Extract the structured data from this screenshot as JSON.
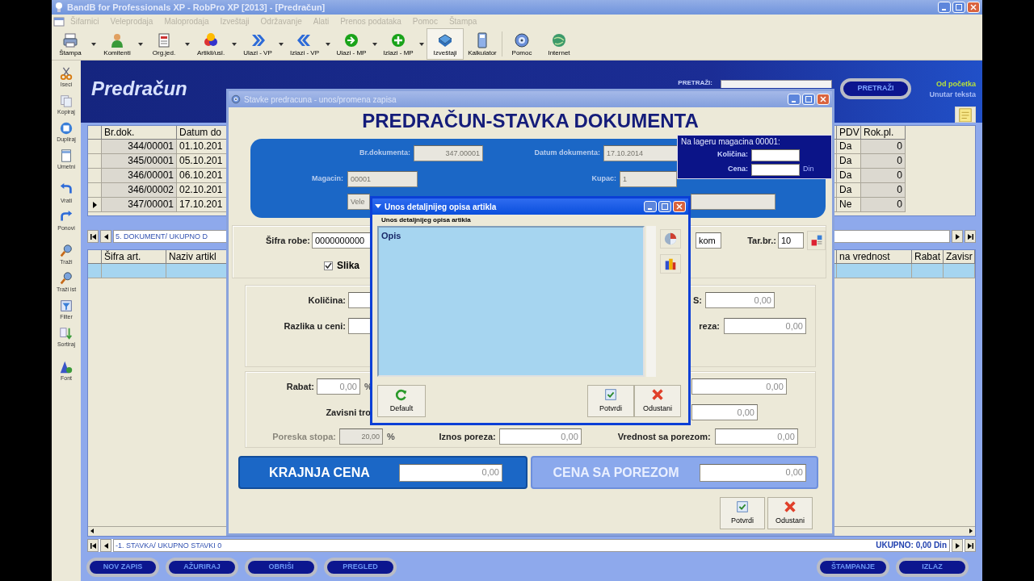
{
  "window": {
    "title": "BandB for Professionals XP - RobPro XP [2013] - [Predračun]"
  },
  "menu": [
    {
      "label": "Šifarnici",
      "disabled": true
    },
    {
      "label": "Veleprodaja",
      "disabled": true
    },
    {
      "label": "Maloprodaja",
      "disabled": true
    },
    {
      "label": "Izveštaji",
      "disabled": true
    },
    {
      "label": "Održavanje",
      "disabled": true
    },
    {
      "label": "Alati",
      "disabled": true
    },
    {
      "label": "Prenos podataka",
      "disabled": true
    },
    {
      "label": "Pomoc",
      "disabled": true
    },
    {
      "label": "Štampa",
      "disabled": true
    }
  ],
  "toolbar": [
    {
      "label": "Štampa",
      "dropdown": true,
      "selected": false
    },
    {
      "label": "Komitenti",
      "dropdown": true,
      "selected": false
    },
    {
      "label": "Org.jed.",
      "dropdown": true,
      "selected": false
    },
    {
      "label": "Artikli/usl.",
      "dropdown": true,
      "selected": false
    },
    {
      "label": "Ulazi - VP",
      "dropdown": true,
      "selected": false
    },
    {
      "label": "Izlazi - VP",
      "dropdown": true,
      "selected": false
    },
    {
      "label": "Ulazi - MP",
      "dropdown": true,
      "selected": false
    },
    {
      "label": "Izlazi - MP",
      "dropdown": true,
      "selected": false
    },
    {
      "label": "Izveštaji",
      "dropdown": false,
      "selected": true
    },
    {
      "label": "Kalkulator",
      "dropdown": false,
      "selected": false
    },
    {
      "label": "Pomoc",
      "dropdown": false,
      "selected": false
    },
    {
      "label": "Internet",
      "dropdown": false,
      "selected": false
    }
  ],
  "side_toolbar": [
    {
      "label": "Iseci"
    },
    {
      "label": "Kopiraj"
    },
    {
      "label": "Dupliraj"
    },
    {
      "label": "Umetni"
    },
    {
      "label": "Vrati"
    },
    {
      "label": "Ponovi"
    },
    {
      "label": "Traži"
    },
    {
      "label": "Traži ist"
    },
    {
      "label": "Filter"
    },
    {
      "label": "Sortiraj"
    },
    {
      "label": "Font"
    }
  ],
  "header": {
    "title": "Predračun",
    "search_label": "PRETRAŽI:",
    "search_button": "PRETRAŽI",
    "options": [
      {
        "label": "Od početka",
        "selected": true
      },
      {
        "label": "Unutar teksta",
        "selected": false
      }
    ]
  },
  "documents": {
    "columns": [
      "Br.dok.",
      "Datum do",
      "PDV",
      "Rok.pl."
    ],
    "rows": [
      {
        "cells": [
          "344/00001",
          "01.10.201",
          "Da",
          "0"
        ],
        "current": false
      },
      {
        "cells": [
          "345/00001",
          "05.10.201",
          "Da",
          "0"
        ],
        "current": false
      },
      {
        "cells": [
          "346/00001",
          "06.10.201",
          "Da",
          "0"
        ],
        "current": false
      },
      {
        "cells": [
          "346/00002",
          "02.10.201",
          "Da",
          "0"
        ],
        "current": false
      },
      {
        "cells": [
          "347/00001",
          "17.10.201",
          "Ne",
          "0"
        ],
        "current": true
      }
    ]
  },
  "documents_nav": "5. DOKUMENT/ UKUPNO D",
  "items": {
    "columns": [
      "Šifra art.",
      "Naziv artikl",
      "na vrednost",
      "Rabat",
      "Zavisr"
    ]
  },
  "items_nav": {
    "text": "-1. STAVKA/ UKUPNO STAVKI 0",
    "total": "UKUPNO: 0,00 Din"
  },
  "buttons_left": [
    "NOV ZAPIS",
    "AŽURIRAJ",
    "OBRIŠI",
    "PREGLED"
  ],
  "buttons_right": [
    "ŠTAMPANJE",
    "IZLAZ"
  ],
  "item_dialog": {
    "title": "Stavke predracuna - unos/promena zapisa",
    "heading": "PREDRAČUN-STAVKA DOKUMENTA",
    "doc_number": {
      "label": "Br.dokumenta:",
      "value": "347.00001",
      "disabled": true
    },
    "doc_date": {
      "label": "Datum dokumenta:",
      "value": "17.10.2014",
      "disabled": true
    },
    "warehouse": {
      "label": "Magacin:",
      "value": "00001",
      "disabled": true
    },
    "buyer": {
      "label": "Kupac:",
      "value": "1",
      "disabled": true
    },
    "warehouse_name": {
      "value": "Vele",
      "disabled": true
    },
    "stock": {
      "title": "Na lageru magacina 00001:",
      "quantity_label": "Količina:",
      "price_label": "Cena:",
      "currency": "Din"
    },
    "article_code": {
      "label": "Šifra robe:",
      "value": "0000000000"
    },
    "unit": {
      "value": "kom"
    },
    "tariff": {
      "label": "Tar.br.:",
      "value": "10"
    },
    "picture_toggle": {
      "label": "Slika",
      "checked": true
    },
    "quantity": {
      "label": "Količina:"
    },
    "price_difference": {
      "label": "Razlika u ceni:"
    },
    "field_s": {
      "label": "S:",
      "value": "0,00"
    },
    "field_tax": {
      "label": "reza:",
      "value": "0,00"
    },
    "discount": {
      "label": "Rabat:",
      "value": "0,00",
      "unit": "%"
    },
    "dependent_costs": {
      "label": "Zavisni tro"
    },
    "value_1": "0,00",
    "value_2": "0,00",
    "tax_rate": {
      "label": "Poreska stopa:",
      "value": "20,00",
      "unit": "%",
      "disabled": true
    },
    "tax_amount": {
      "label": "Iznos poreza:",
      "value": "0,00"
    },
    "value_with_tax": {
      "label": "Vrednost sa porezom:",
      "value": "0,00"
    },
    "final_price": {
      "label": "KRAJNJA CENA",
      "value": "0,00"
    },
    "price_with_tax": {
      "label": "CENA SA POREZOM",
      "value": "0,00"
    },
    "buttons": [
      "Potvrdi",
      "Odustani"
    ]
  },
  "description_dialog": {
    "title": "Unos detaljnijeg opisa artikla",
    "label": "Unos detaljnijeg opisa artikla",
    "value": "Opis",
    "buttons": [
      "Default",
      "Potvrdi",
      "Odustani"
    ]
  }
}
